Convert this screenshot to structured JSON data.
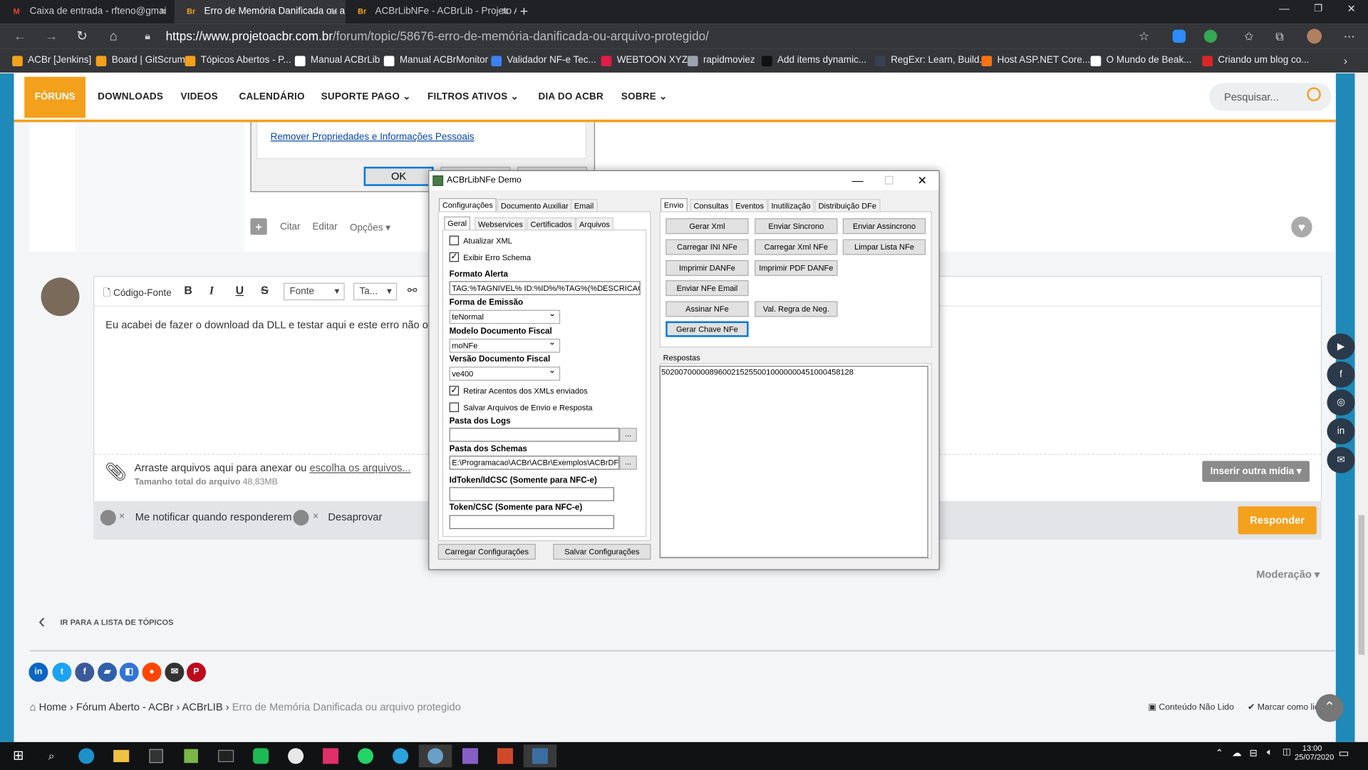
{
  "browser": {
    "tabs": [
      {
        "title": "Caixa de entrada - rfteno@gmai",
        "icon": "M",
        "color": "#ea4335"
      },
      {
        "title": "Erro de Memória Danificada ou a",
        "icon": "Br",
        "color": "#f3a01c"
      },
      {
        "title": "ACBrLibNFe - ACBrLib - Projeto A",
        "icon": "Br",
        "color": "#f3a01c"
      }
    ],
    "url_host": "https://www.projetoacbr.com.br",
    "url_path": "/forum/topic/58676-erro-de-memória-danificada-ou-arquivo-protegido/",
    "bookmarks": [
      {
        "label": "ACBr [Jenkins]",
        "color": "#f3a01c"
      },
      {
        "label": "Board | GitScrum",
        "color": "#f3a01c"
      },
      {
        "label": "Tópicos Abertos - P...",
        "color": "#f3a01c"
      },
      {
        "label": "Manual ACBrLib",
        "color": "#ffffff"
      },
      {
        "label": "Manual ACBrMonitor",
        "color": "#ffffff"
      },
      {
        "label": "Validador NF-e Tec...",
        "color": "#3b82f6"
      },
      {
        "label": "WEBTOON XYZ",
        "color": "#e11d48"
      },
      {
        "label": "rapidmoviez",
        "color": "#9ca3af"
      },
      {
        "label": "Add items dynamic...",
        "color": "#111111"
      },
      {
        "label": "RegExr: Learn, Build...",
        "color": "#374151"
      },
      {
        "label": "Host ASP.NET Core...",
        "color": "#f97316"
      },
      {
        "label": "O Mundo de Beak...",
        "color": "#ffffff"
      },
      {
        "label": "Criando um blog co...",
        "color": "#dc2626"
      }
    ]
  },
  "site": {
    "nav": [
      "FÓRUNS",
      "DOWNLOADS",
      "VIDEOS",
      "CALENDÁRIO",
      "SUPORTE PAGO",
      "FILTROS ATIVOS",
      "DIA DO ACBR",
      "SOBRE"
    ],
    "search_placeholder": "Pesquisar...",
    "remove_props_link": "Remover Propriedades e Informações Pessoais",
    "ok": "OK",
    "post_actions": {
      "quote": "Citar",
      "edit": "Editar",
      "options": "Opções"
    },
    "editor": {
      "source": "Código-Fonte",
      "bold": "B",
      "italic": "I",
      "underline": "U",
      "strike": "S",
      "font": "Fonte",
      "size": "Ta...",
      "body": "Eu acabei de fazer o download da DLL e testar aqui e este erro não ocorr"
    },
    "attach": {
      "text": "Arraste arquivos aqui para anexar ou",
      "link": "escolha os arquivos...",
      "size_label": "Tamanho total do arquivo",
      "size_value": "48,83MB"
    },
    "insert_media": "Inserir outra mídia",
    "notify": "Me notificar quando responderem",
    "disapprove": "Desaprovar",
    "reply": "Responder",
    "moderation": "Moderação",
    "back_to_list": "IR PARA A LISTA DE TÓPICOS",
    "breadcrumb": [
      "Home",
      "Fórum Aberto - ACBr",
      "ACBrLIB",
      "Erro de Memória Danificada ou arquivo protegido"
    ],
    "unread": "Conteúdo Não Lido",
    "mark_read": "Marcar como lido"
  },
  "app": {
    "title": "ACBrLibNFe Demo",
    "left_tabs": [
      "Configurações",
      "Documento Auxiliar",
      "Email"
    ],
    "sub_tabs": [
      "Geral",
      "Webservices",
      "Certificados",
      "Arquivos"
    ],
    "atualizar_xml": "Atualizar XML",
    "exibir_erro": "Exibir Erro Schema",
    "formato_alerta_label": "Formato Alerta",
    "formato_alerta_value": "TAG:%TAGNIVEL% ID:%ID%/%TAG%(%DESCRICAO%",
    "forma_emissao_label": "Forma de Emissão",
    "forma_emissao_value": "teNormal",
    "modelo_label": "Modelo Documento Fiscal",
    "modelo_value": "moNFe",
    "versao_label": "Versão Documento Fiscal",
    "versao_value": "ve400",
    "retirar_acentos": "Retirar Acentos dos XMLs enviados",
    "salvar_arquivos": "Salvar Arquivos de Envio e Resposta",
    "pasta_logs_label": "Pasta dos Logs",
    "pasta_logs_value": "",
    "pasta_schemas_label": "Pasta dos Schemas",
    "pasta_schemas_value": "E:\\Programacao\\ACBr\\ACBr\\Exemplos\\ACBrDFe",
    "idtoken_label": "IdToken/IdCSC (Somente para NFC-e)",
    "token_label": "Token/CSC (Somente para NFC-e)",
    "browse": "...",
    "carregar_config": "Carregar Configurações",
    "salvar_config": "Salvar Configurações",
    "right_tabs": [
      "Envio",
      "Consultas",
      "Eventos",
      "Inutilização",
      "Distribuição DFe"
    ],
    "buttons": [
      "Gerar Xml",
      "Enviar Sincrono",
      "Enviar Assincrono",
      "Carregar INI NFe",
      "Carregar Xml NFe",
      "Limpar Lista NFe",
      "Imprimir DANFe",
      "Imprimir PDF DANFe",
      "Enviar NFe Email",
      "Assinar NFe",
      "Val. Regra de Neg.",
      "Gerar Chave NFe"
    ],
    "respostas_label": "Respostas",
    "respostas_value": "50200700000896002152550010000000451000458128"
  },
  "taskbar": {
    "time": "13:00",
    "date": "25/07/2020"
  },
  "colors": {
    "accent": "#f3a01c",
    "side": "#1f89b7",
    "win_focus": "#0078d7"
  }
}
